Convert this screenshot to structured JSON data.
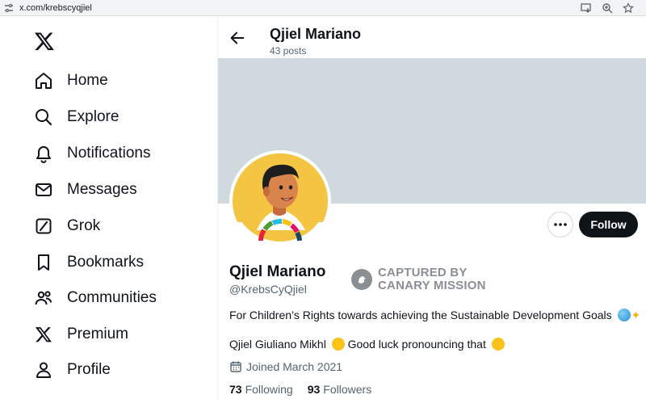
{
  "browser": {
    "url": "x.com/krebscyqjiel"
  },
  "nav": {
    "items": [
      {
        "label": "Home",
        "icon": "home-icon"
      },
      {
        "label": "Explore",
        "icon": "search-icon"
      },
      {
        "label": "Notifications",
        "icon": "bell-icon"
      },
      {
        "label": "Messages",
        "icon": "envelope-icon"
      },
      {
        "label": "Grok",
        "icon": "grok-icon"
      },
      {
        "label": "Bookmarks",
        "icon": "bookmark-icon"
      },
      {
        "label": "Communities",
        "icon": "people-icon"
      },
      {
        "label": "Premium",
        "icon": "x-logo-icon"
      },
      {
        "label": "Profile",
        "icon": "person-icon"
      }
    ]
  },
  "header": {
    "name": "Qjiel Mariano",
    "posts": "43 posts"
  },
  "profile": {
    "name": "Qjiel Mariano",
    "handle": "@KrebsCyQjiel",
    "follow_label": "Follow",
    "bio": "For Children’s Rights towards achieving the Sustainable Development Goals",
    "bio2": "Qjiel Giuliano Mikhl",
    "bio2_b": "Good luck pronouncing that",
    "joined": "Joined March 2021",
    "following_count": "73",
    "following_label": "Following",
    "followers_count": "93",
    "followers_label": "Followers"
  },
  "stamp": {
    "line1": "CAPTURED BY",
    "line2": "CANARY MISSION"
  },
  "colors": {
    "banner": "#cfd9de",
    "follow_bg": "#0f1419",
    "secondary_text": "#536471",
    "avatar_bg": "#f4c542"
  }
}
